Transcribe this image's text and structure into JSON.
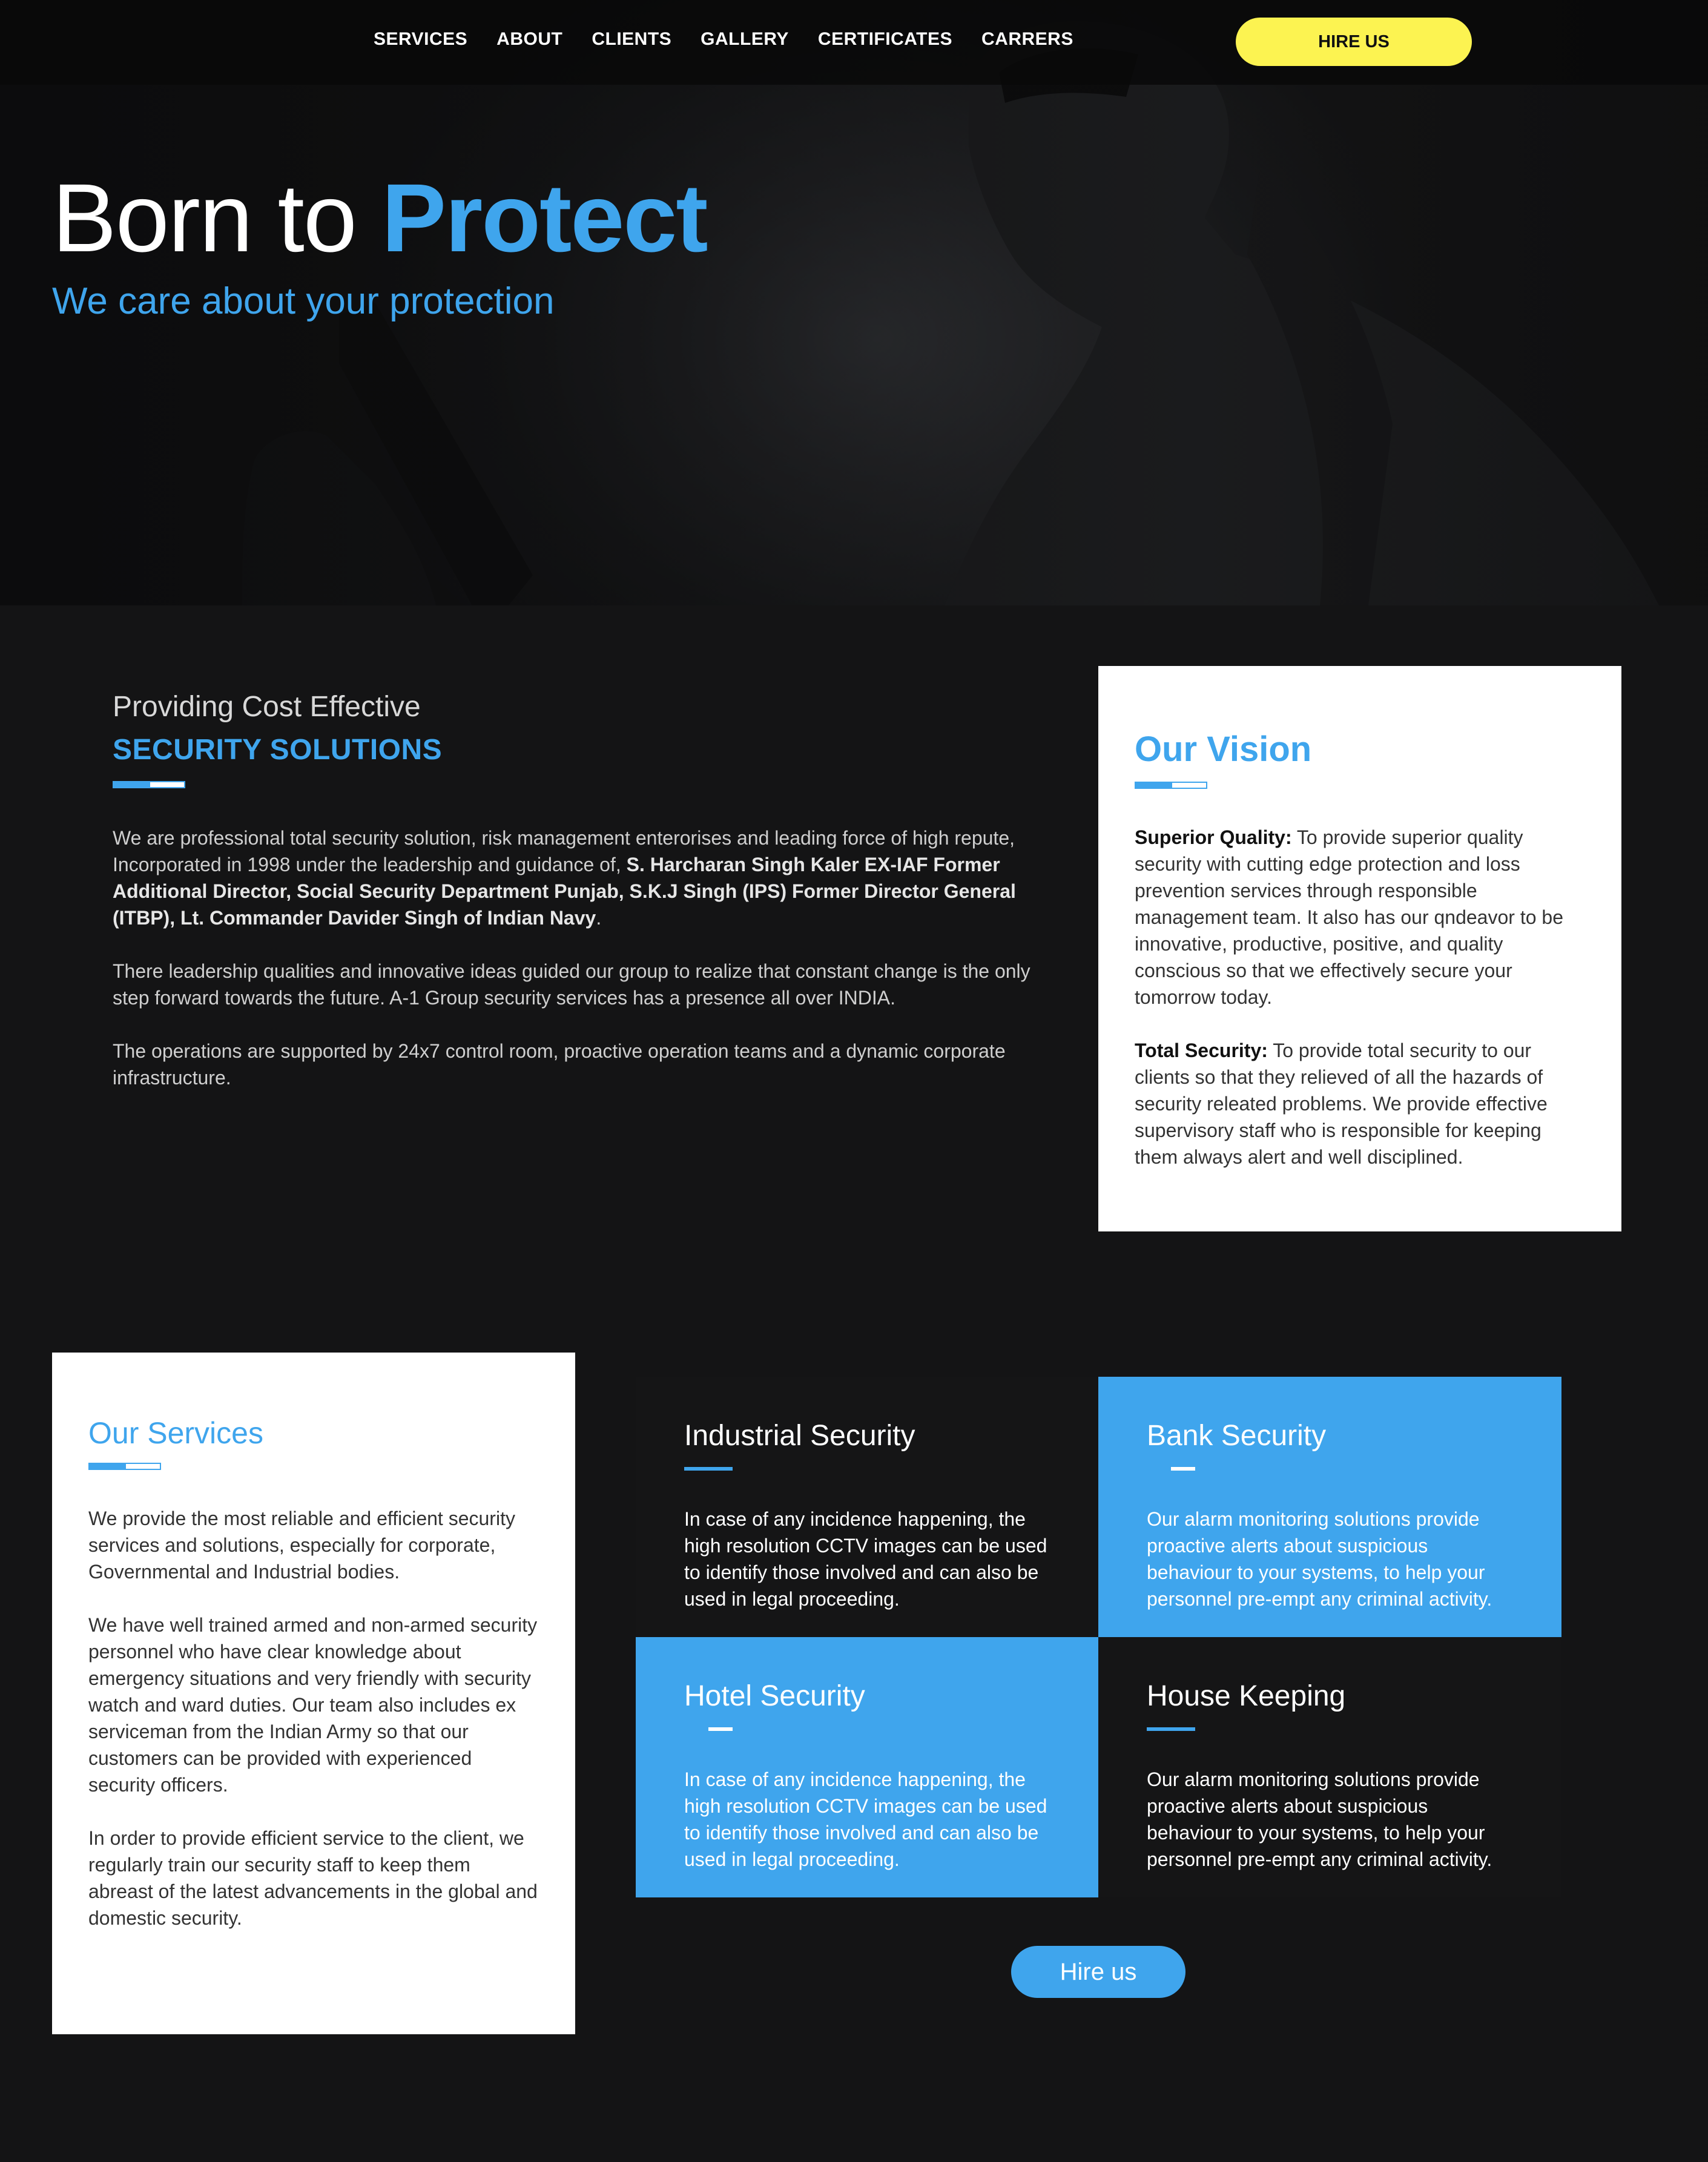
{
  "nav": {
    "links": [
      "SERVICES",
      "ABOUT",
      "CLIENTS",
      "GALLERY",
      "CERTIFICATES",
      "CARRERS"
    ],
    "hire_label": "HIRE US"
  },
  "hero": {
    "title_plain": "Born to ",
    "title_strong": "Protect",
    "subtitle": "We care about your protection"
  },
  "about": {
    "kicker": "Providing Cost Effective",
    "heading": "SECURITY SOLUTIONS",
    "p1_plain": "We are professional total security solution, risk management enterorises and leading force of high repute, Incorporated in 1998 under the leadership and guidance of, ",
    "p1_bold": "S. Harcharan Singh Kaler EX-IAF Former Additional Director, Social Security Department Punjab, S.K.J Singh (IPS) Former Director General (ITBP), Lt. Commander Davider Singh of Indian Navy",
    "p1_end": ".",
    "p2": "There leadership qualities and innovative ideas guided our group to realize that constant change is the only step forward towards the future. A-1 Group security services has a presence all over INDIA.",
    "p3": "The operations are supported by 24x7 control room, proactive operation teams and a dynamic corporate infrastructure."
  },
  "vision": {
    "title": "Our Vision",
    "item1_label": "Superior Quality:",
    "item1_text": " To provide superior quality security with cutting edge protection and loss prevention services through responsible management team. It also has our qndeavor to be innovative, productive, positive, and quality conscious so that we effectively secure your tomorrow today.",
    "item2_label": "Total Security:",
    "item2_text": " To provide total security to our clients so that they relieved of all the hazards of security releated problems. We provide effective supervisory staff who is responsible for keeping them always alert and well disciplined."
  },
  "services": {
    "title": "Our Services",
    "p1": "We provide the most reliable and efficient security services and solutions, especially for corporate, Governmental and Industrial bodies.",
    "p2": "We have well trained armed and non-armed security personnel who have clear knowledge about emergency situations and very friendly with security watch and ward duties. Our team also includes ex serviceman from the Indian Army so that our customers can be provided with experienced security officers.",
    "p3": "In order to provide efficient service to the client, we regularly train our security staff to keep them abreast of the latest advancements in the global and domestic security."
  },
  "tiles": [
    {
      "title": "Industrial Security",
      "text": "In case of any incidence happening, the high resolution CCTV images can be used to identify those involved and can also be used in legal proceeding."
    },
    {
      "title": "Bank Security",
      "text": "Our alarm monitoring solutions provide proactive alerts about suspicious behaviour to your systems, to help your personnel pre-empt any criminal activity."
    },
    {
      "title": "Hotel Security",
      "text": "In case of any incidence happening, the high resolution CCTV images can be used to identify those involved and can also be used in legal proceeding."
    },
    {
      "title": "House Keeping",
      "text": "Our alarm monitoring solutions provide proactive alerts about suspicious behaviour to your systems, to help your personnel pre-empt any criminal activity."
    }
  ],
  "cta": {
    "label": "Hire us"
  },
  "colors": {
    "accent": "#3fa5ed",
    "hire_yellow": "#fcf351",
    "background": "#141415"
  }
}
